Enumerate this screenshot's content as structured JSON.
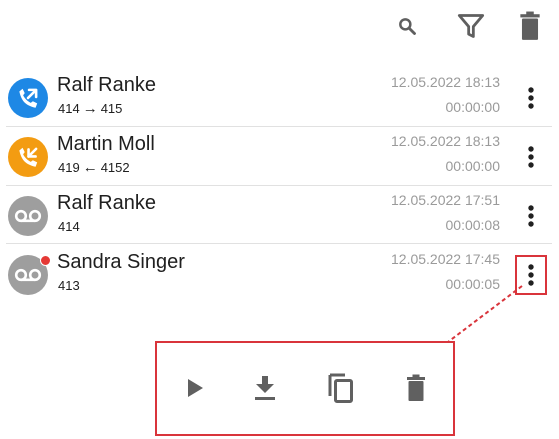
{
  "toolbar": {
    "icons": [
      "search-icon",
      "filter-icon",
      "trash-icon"
    ]
  },
  "calls": [
    {
      "name": "Ralf Ranke",
      "from": "414",
      "direction": "outgoing",
      "to": "415",
      "date": "12.05.2022 18:13",
      "duration": "00:00:00",
      "avatar_icon": "outgoing-call-icon",
      "avatar_color": "#1e88e5"
    },
    {
      "name": "Martin Moll",
      "from": "419",
      "direction": "incoming",
      "to": "4152",
      "date": "12.05.2022 18:13",
      "duration": "00:00:00",
      "avatar_icon": "incoming-call-icon",
      "avatar_color": "#f39c12"
    },
    {
      "name": "Ralf Ranke",
      "from": "414",
      "direction": "",
      "to": "",
      "date": "12.05.2022 17:51",
      "duration": "00:00:08",
      "avatar_icon": "voicemail-icon",
      "avatar_color": "#9e9e9e"
    },
    {
      "name": "Sandra Singer",
      "from": "413",
      "direction": "",
      "to": "",
      "date": "12.05.2022 17:45",
      "duration": "00:00:05",
      "avatar_icon": "voicemail-icon",
      "avatar_color": "#9e9e9e",
      "unread": true
    }
  ],
  "context_menu": {
    "icons": [
      "play-icon",
      "download-icon",
      "copy-icon",
      "delete-icon"
    ]
  },
  "colors": {
    "highlight": "#d9343b",
    "icon_gray": "#606060",
    "meta_gray": "#9a9a9a"
  }
}
